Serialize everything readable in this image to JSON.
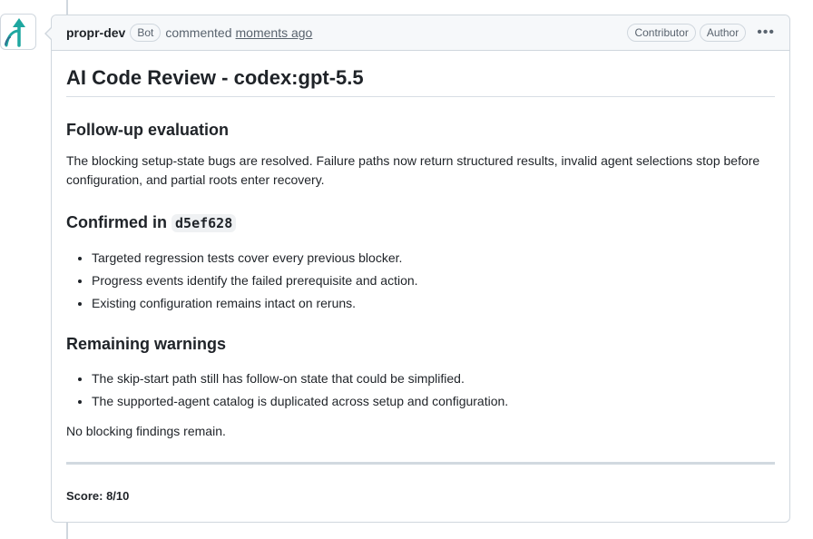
{
  "comment": {
    "author": "propr-dev",
    "bot_badge": "Bot",
    "action": "commented",
    "timestamp": "moments ago",
    "badges": [
      "Contributor",
      "Author"
    ],
    "menu_icon": "kebab-horizontal-icon",
    "avatar_icon": "propr-logo-icon",
    "accent_color": "#1ea7a0"
  },
  "review": {
    "title": "AI Code Review - codex:gpt-5.5",
    "followup": {
      "heading": "Follow-up evaluation",
      "text": "The blocking setup-state bugs are resolved. Failure paths now return structured results, invalid agent selections stop before configuration, and partial roots enter recovery."
    },
    "confirmed": {
      "heading_prefix": "Confirmed in",
      "commit": "d5ef628",
      "items": [
        "Targeted regression tests cover every previous blocker.",
        "Progress events identify the failed prerequisite and action.",
        "Existing configuration remains intact on reruns."
      ]
    },
    "warnings": {
      "heading": "Remaining warnings",
      "items": [
        "The skip-start path still has follow-on state that could be simplified.",
        "The supported-agent catalog is duplicated across setup and configuration."
      ]
    },
    "conclusion": "No blocking findings remain.",
    "score": "Score: 8/10"
  }
}
